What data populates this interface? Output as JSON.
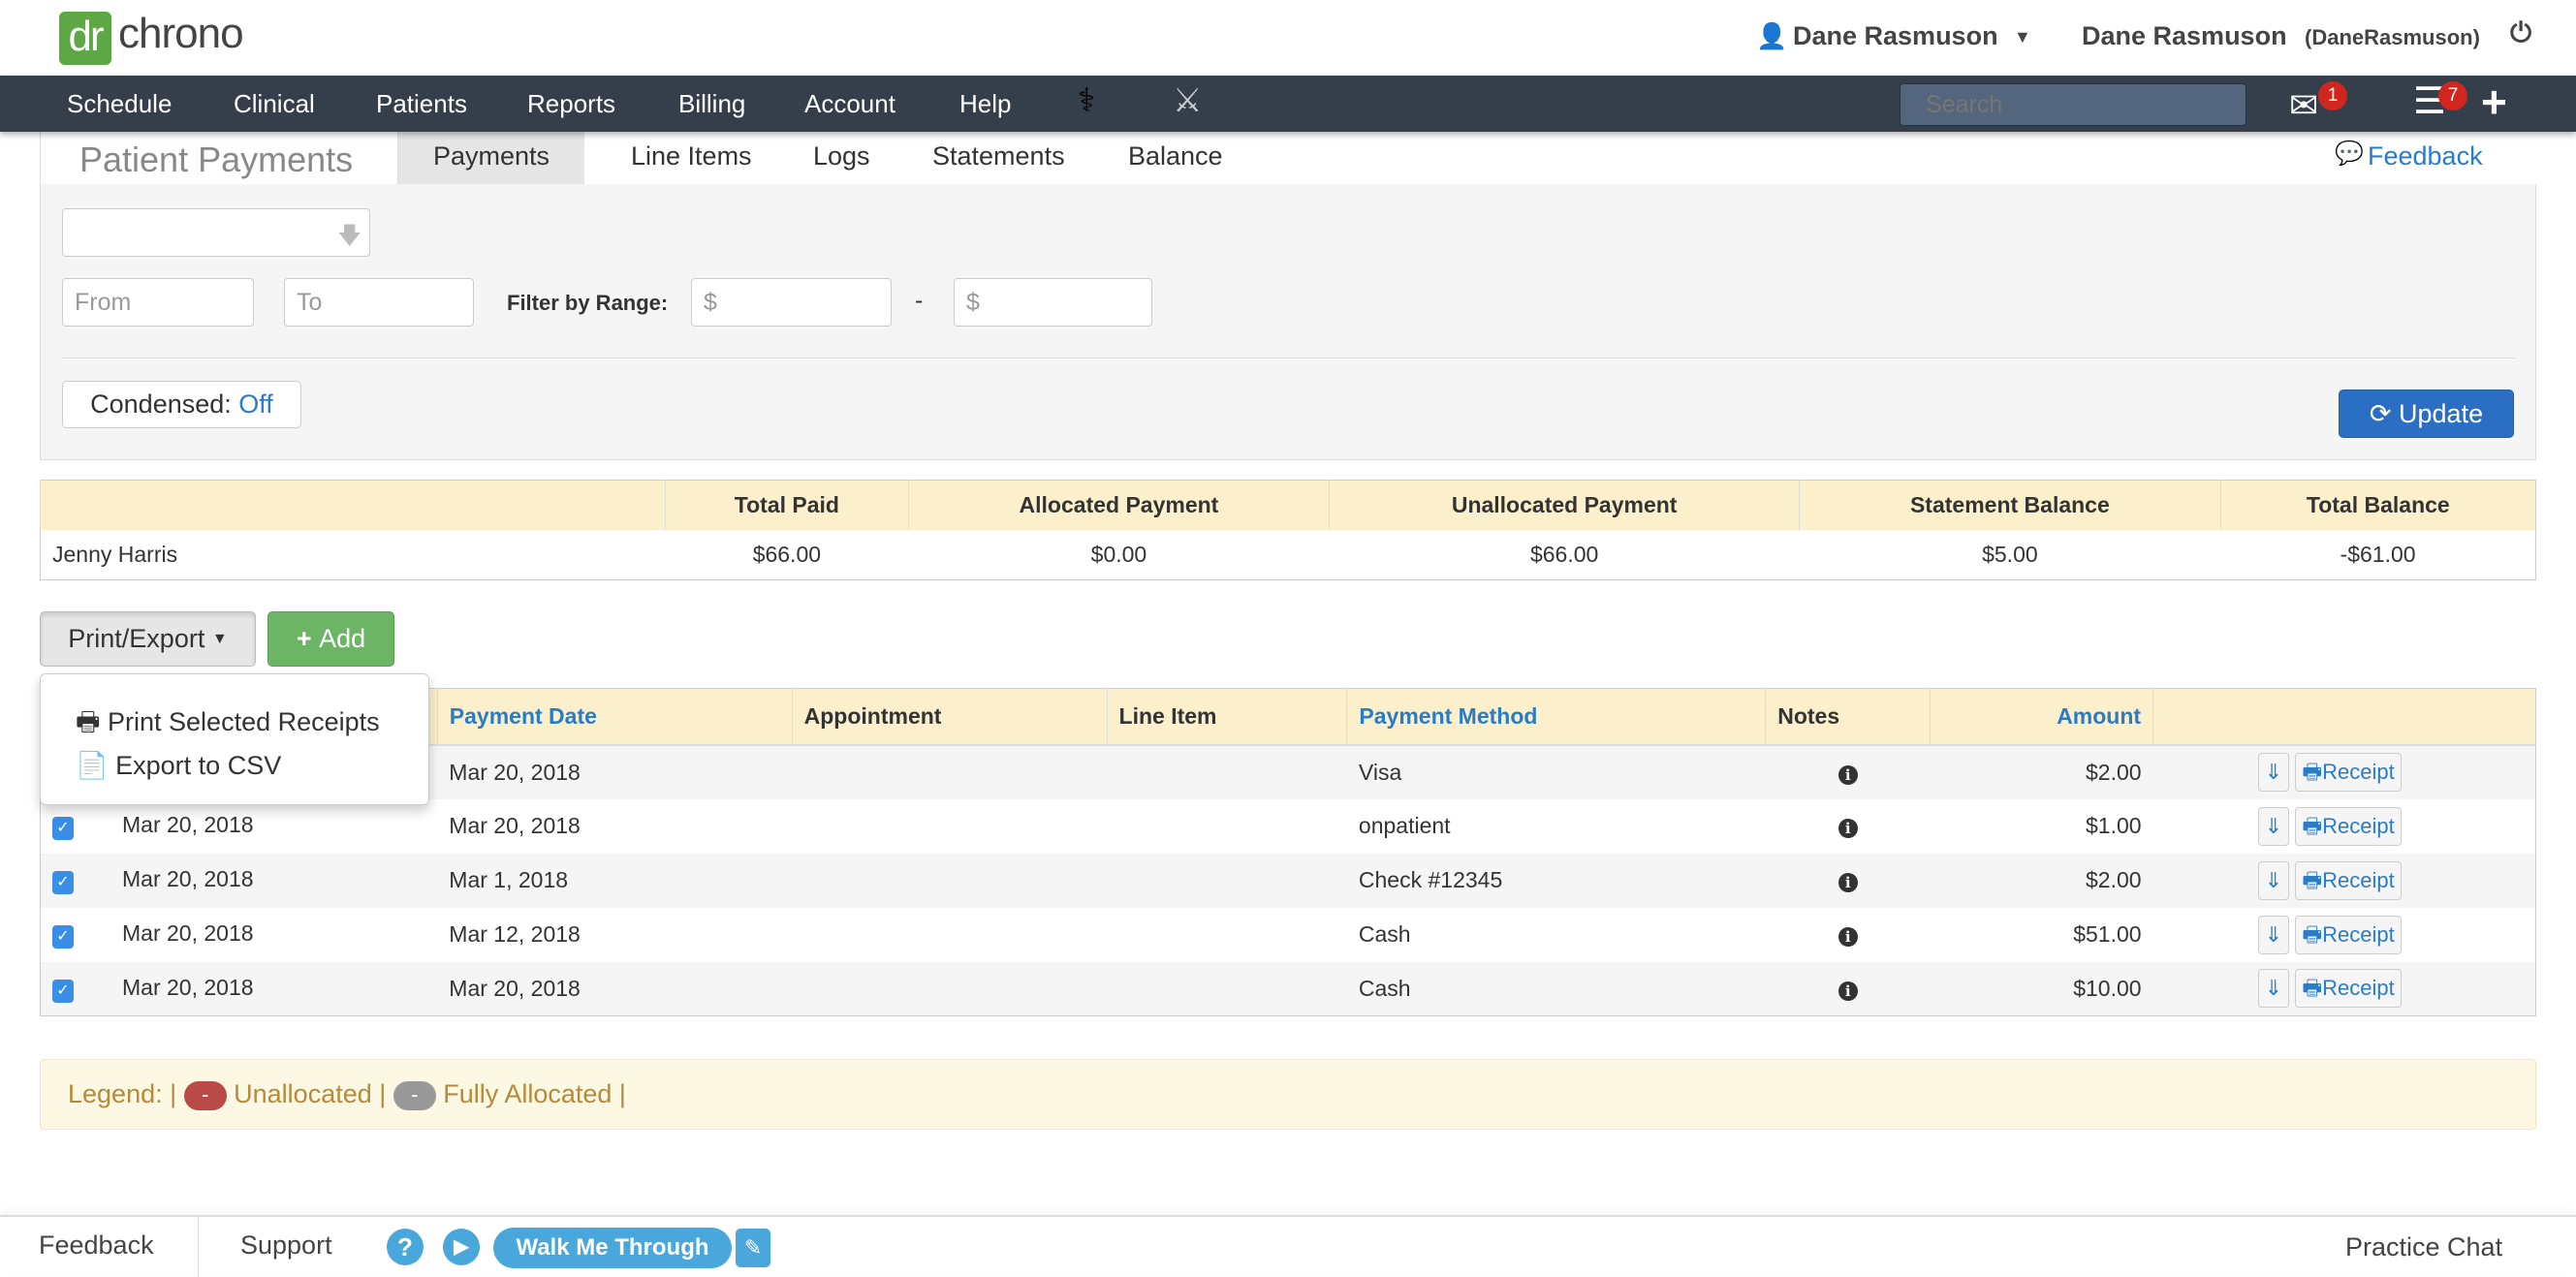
{
  "header": {
    "logo_dr": "dr",
    "logo_chrono": "chrono",
    "user_menu": "Dane Rasmuson",
    "user_full": "Dane Rasmuson",
    "username": "(DaneRasmuson)"
  },
  "nav": {
    "items": [
      "Schedule",
      "Clinical",
      "Patients",
      "Reports",
      "Billing",
      "Account",
      "Help"
    ],
    "search_placeholder": "Search",
    "messages_count": "1",
    "tasks_count": "7"
  },
  "tabs": {
    "title": "Patient Payments",
    "items": [
      "Payments",
      "Line Items",
      "Logs",
      "Statements",
      "Balance"
    ],
    "active": "Payments",
    "feedback": "Feedback"
  },
  "filters": {
    "from_placeholder": "From",
    "to_placeholder": "To",
    "range_label": "Filter by Range:",
    "min_placeholder": "$",
    "range_dash": "-",
    "max_placeholder": "$",
    "condensed_label": "Condensed:",
    "condensed_value": "Off",
    "update_label": "Update"
  },
  "summary": {
    "headers": [
      "",
      "Total Paid",
      "Allocated Payment",
      "Unallocated Payment",
      "Statement Balance",
      "Total Balance"
    ],
    "row": [
      "Jenny Harris",
      "$66.00",
      "$0.00",
      "$66.00",
      "$5.00",
      "-$61.00"
    ]
  },
  "actions": {
    "print_export": "Print/Export",
    "add": "Add",
    "menu": [
      "Print Selected Receipts",
      "Export to CSV"
    ]
  },
  "payments": {
    "headers": [
      "",
      "Payment Date",
      "Appointment",
      "Line Item",
      "Payment Method",
      "Notes",
      "Amount",
      ""
    ],
    "receipt_label": "Receipt",
    "rows": [
      {
        "date": "Mar 20, 2018",
        "payment_date": "Mar 20, 2018",
        "method": "Visa",
        "amount": "$2.00"
      },
      {
        "date": "Mar 20, 2018",
        "payment_date": "Mar 20, 2018",
        "method": "onpatient",
        "amount": "$1.00"
      },
      {
        "date": "Mar 20, 2018",
        "payment_date": "Mar 1, 2018",
        "method": "Check #12345",
        "amount": "$2.00"
      },
      {
        "date": "Mar 20, 2018",
        "payment_date": "Mar 12, 2018",
        "method": "Cash",
        "amount": "$51.00"
      },
      {
        "date": "Mar 20, 2018",
        "payment_date": "Mar 20, 2018",
        "method": "Cash",
        "amount": "$10.00"
      }
    ]
  },
  "legend": {
    "label": "Legend: |",
    "pill": "-",
    "unallocated": "Unallocated |",
    "fully": "Fully Allocated |",
    "unallocated_color": "#b94a48",
    "fully_color": "#999999"
  },
  "footer": {
    "feedback": "Feedback",
    "support": "Support",
    "walk": "Walk Me Through",
    "chat": "Practice Chat"
  },
  "colors": {
    "nav": "#353f4b",
    "brand": "#5da744",
    "primary": "#2b7cc6",
    "add": "#6cb565"
  }
}
